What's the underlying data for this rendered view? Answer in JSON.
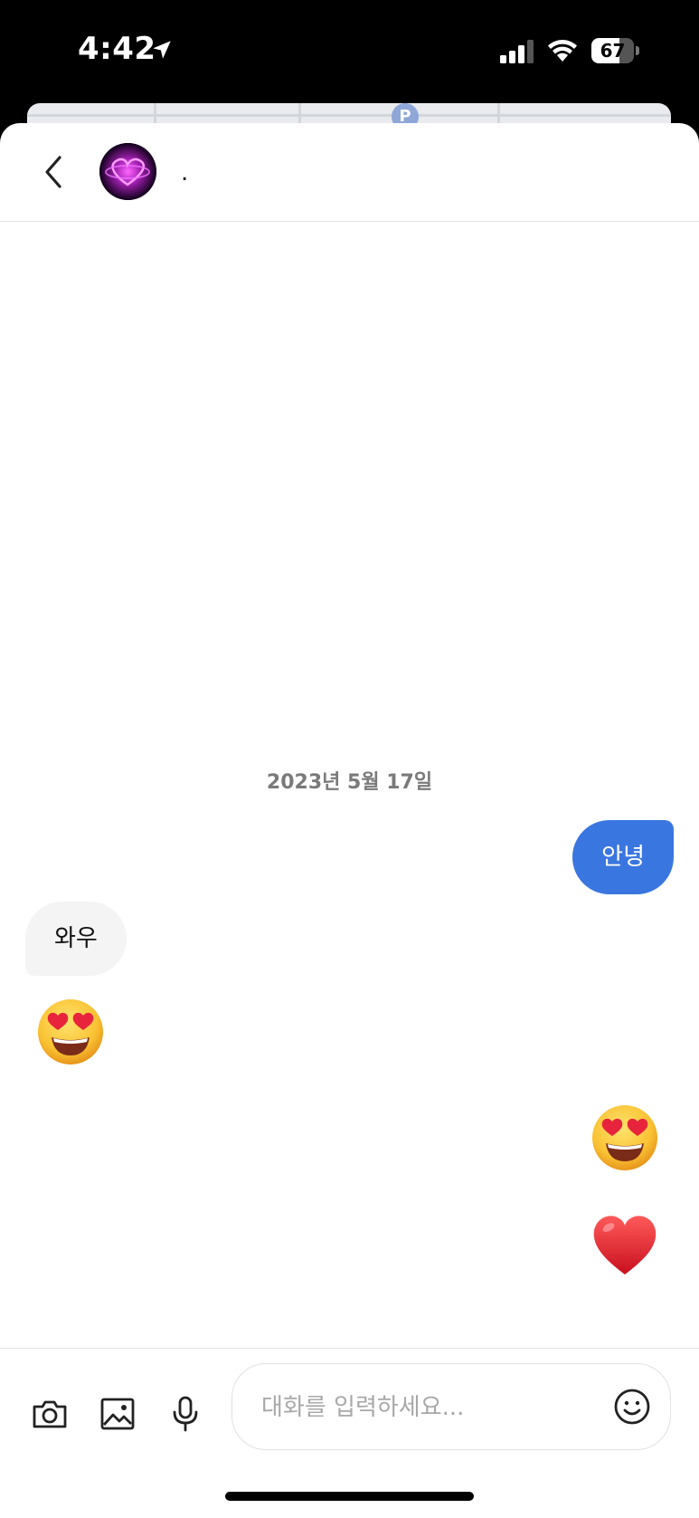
{
  "status_bar": {
    "time": "4:42",
    "battery_level": "67",
    "battery_fraction": 0.67,
    "icons": [
      "location-arrow-icon",
      "signal-icon",
      "wifi-icon",
      "battery-icon"
    ]
  },
  "background_map": {
    "parking_label": "P"
  },
  "header": {
    "back_icon": "chevron-left-icon",
    "avatar": "profile-avatar",
    "contact_name": "."
  },
  "conversation": {
    "date_separator": "2023년 5월 17일",
    "messages": [
      {
        "direction": "outgoing",
        "type": "text",
        "text": "안녕"
      },
      {
        "direction": "incoming",
        "type": "text",
        "text": "와우"
      },
      {
        "direction": "incoming",
        "type": "emoji",
        "emoji": "heart-eyes-emoji"
      },
      {
        "direction": "outgoing",
        "type": "emoji",
        "emoji": "heart-eyes-emoji"
      },
      {
        "direction": "outgoing",
        "type": "emoji",
        "emoji": "red-heart-emoji"
      }
    ]
  },
  "composer": {
    "placeholder": "대화를 입력하세요...",
    "value": "",
    "tools": [
      "camera-icon",
      "image-icon",
      "microphone-icon",
      "smiley-icon"
    ]
  },
  "colors": {
    "outgoing_bubble": "#3a76e0",
    "incoming_bubble": "#f4f4f4",
    "date_text": "#7a7a7a"
  }
}
